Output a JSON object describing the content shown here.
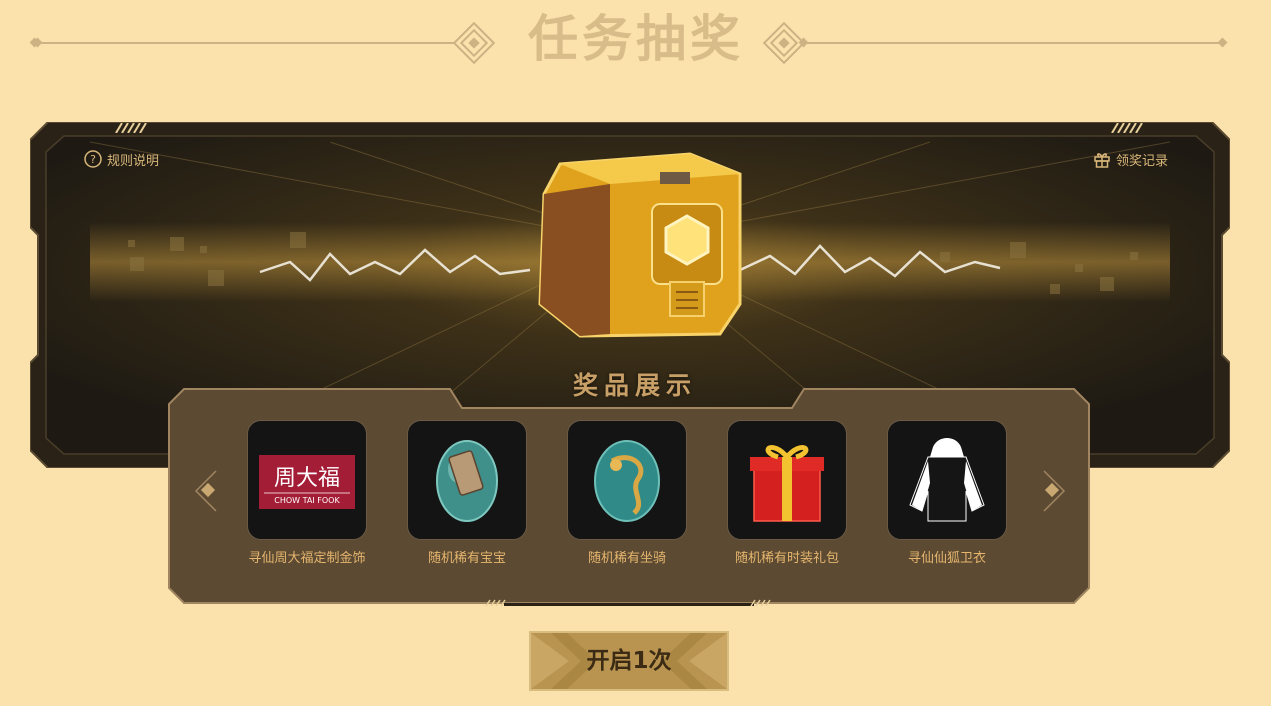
{
  "header": {
    "title": "任务抽奖"
  },
  "top_links": {
    "rules_label": "规则说明",
    "records_label": "领奖记录"
  },
  "prize_section": {
    "heading": "奖品展示",
    "items": [
      {
        "label": "寻仙周大福定制金饰",
        "icon": "chow-tai-fook-logo",
        "logo_cn": "周大福",
        "logo_en": "CHOW TAI FOOK"
      },
      {
        "label": "随机稀有宝宝",
        "icon": "pet-egg-icon"
      },
      {
        "label": "随机稀有坐骑",
        "icon": "mount-egg-icon"
      },
      {
        "label": "随机稀有时装礼包",
        "icon": "gift-box-icon"
      },
      {
        "label": "寻仙仙狐卫衣",
        "icon": "hoodie-icon"
      }
    ]
  },
  "actions": {
    "open_label": "开启1次"
  },
  "colors": {
    "background": "#fbe2ac",
    "panel_dark": "#2a2216",
    "prize_panel": "#5c4a33",
    "accent_gold": "#d9b77a",
    "label_gold": "#e6b66e",
    "button_gold": "#b89450"
  }
}
